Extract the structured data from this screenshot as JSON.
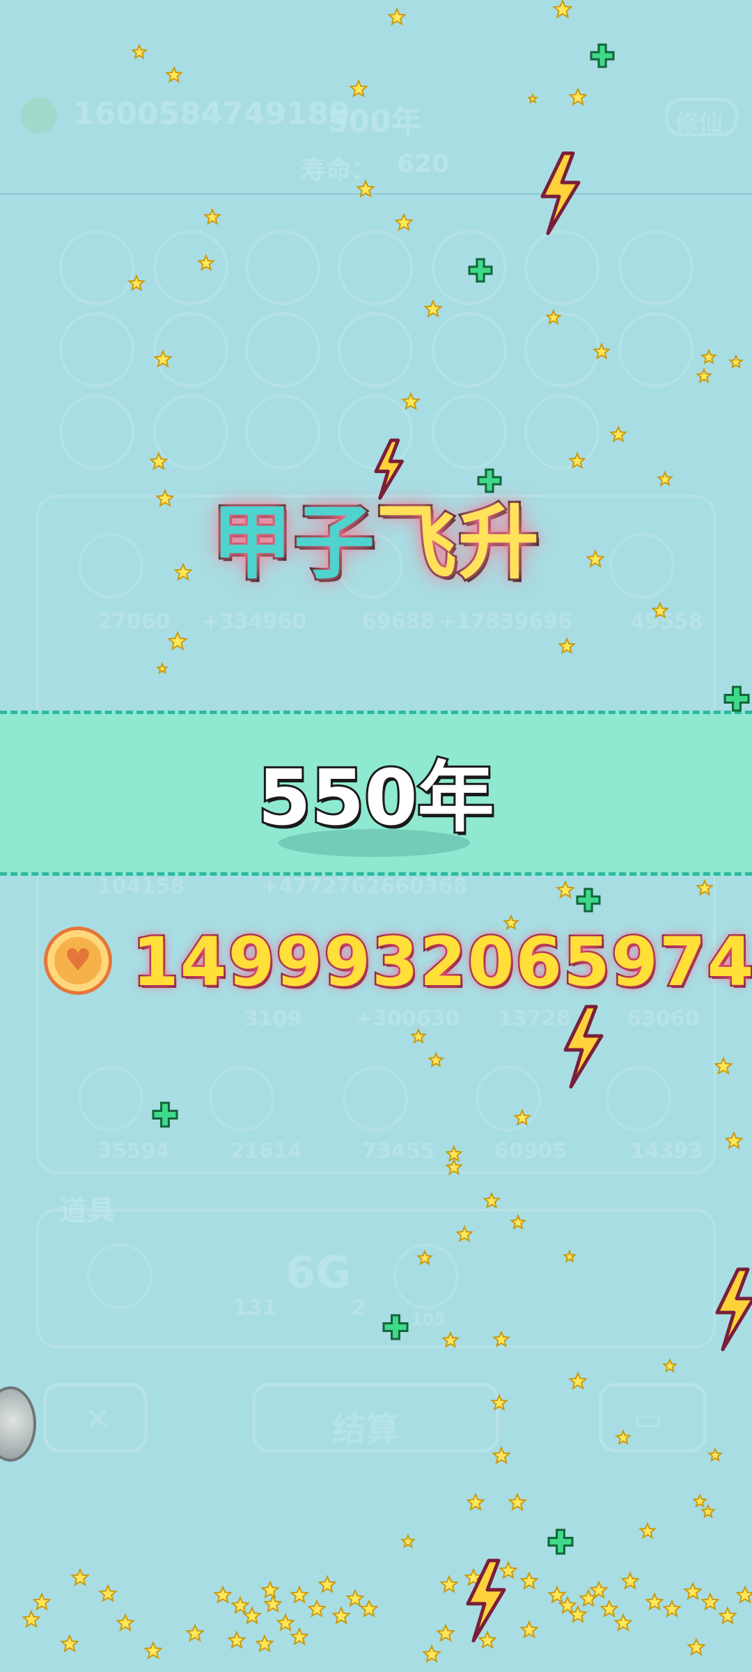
{
  "header": {
    "id_text": "1600584749189",
    "age_text": "500年",
    "lifespan_label": "寿命：",
    "lifespan_value": "620",
    "cultivate_button": "修仙"
  },
  "background_numbers": {
    "row1": [
      "27060",
      "+334960",
      "69688",
      "+17839696",
      "49558"
    ],
    "row2": [
      "104158",
      "+4772762660368"
    ],
    "row3": [
      "3109",
      "+300630",
      "13728",
      "63060"
    ],
    "row4": [
      "35594",
      "21614",
      "73455",
      "60905",
      "14393"
    ]
  },
  "items_section": {
    "title": "道具",
    "values": [
      "131",
      "2",
      "105"
    ],
    "label_6g": "6G"
  },
  "bottom_bar": {
    "settle_button": "结算"
  },
  "overlay": {
    "title_part1": "甲子",
    "title_part2": "飞升",
    "years_value": "550年",
    "coin_icon": "heart-coin-icon",
    "coin_value": "1499932065974"
  },
  "colors": {
    "background": "#a8dde3",
    "band": "#8ee9d0",
    "coin_gold": "#ffdf38",
    "title_teal": "#4fd3cf",
    "title_yellow": "#ffe25a"
  }
}
